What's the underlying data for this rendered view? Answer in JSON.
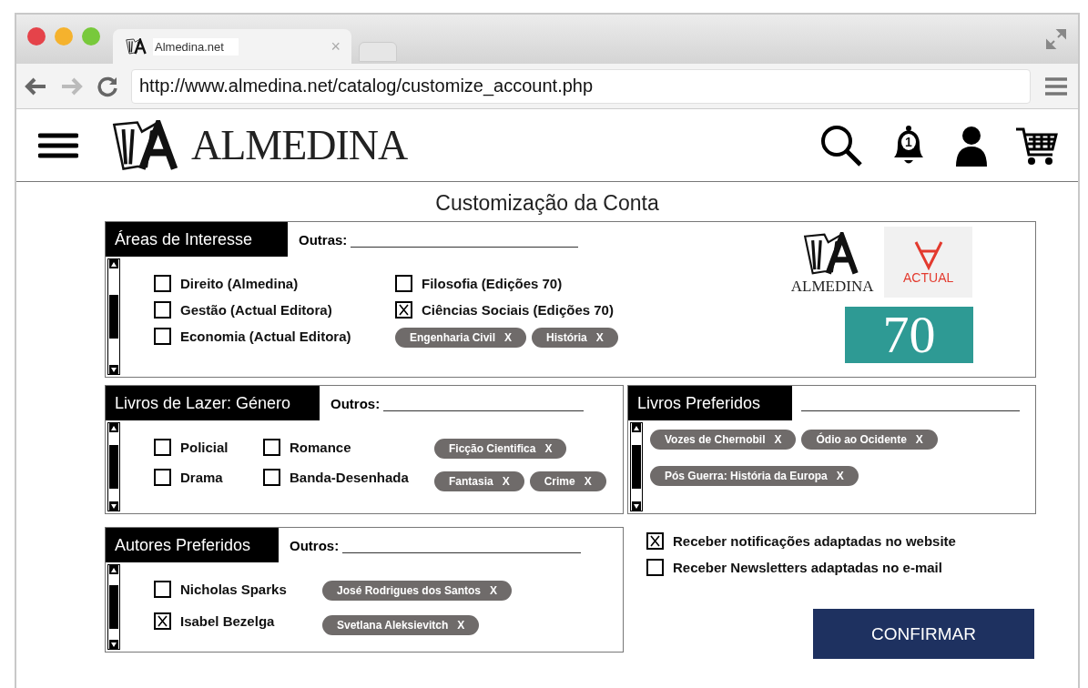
{
  "browser": {
    "tab": {
      "title": "Almedina.net",
      "close": "×"
    },
    "address": "http://www.almedina.net/catalog/customize_account.php"
  },
  "header": {
    "logo": "ALMEDINA",
    "notification_count": "1"
  },
  "page_title": "Customização da Conta",
  "sections": [
    {
      "kind": "areas",
      "title": "Áreas de Interesse",
      "other_label": "Outras:",
      "columns": [
        [
          {
            "kind": "checkbox",
            "label": "Direito (Almedina)",
            "checked": false
          },
          {
            "kind": "checkbox",
            "label": "Gestão (Actual Editora)",
            "checked": false
          },
          {
            "kind": "checkbox",
            "label": "Economia (Actual Editora)",
            "checked": false
          }
        ],
        [
          {
            "kind": "checkbox",
            "label": "Filosofia (Edições 70)",
            "checked": false
          },
          {
            "kind": "checkbox",
            "label": "Ciências Sociais (Edições 70)",
            "checked": true
          },
          {
            "kind": "chips",
            "chips": [
              {
                "label": "Engenharia Civil",
                "remove": "X"
              },
              {
                "label": "História",
                "remove": "X"
              }
            ]
          }
        ]
      ],
      "logos": [
        {
          "kind": "almedina",
          "text": "ALMEDINA"
        },
        {
          "kind": "actual",
          "text": "ACTUAL"
        },
        {
          "kind": "seventy",
          "text": "70"
        }
      ]
    },
    {
      "kind": "lazer",
      "title": "Livros de Lazer: Género",
      "other_label": "Outros:",
      "columns": [
        [
          {
            "kind": "checkbox",
            "label": "Policial",
            "checked": false
          },
          {
            "kind": "checkbox",
            "label": "Drama",
            "checked": false
          }
        ],
        [
          {
            "kind": "checkbox",
            "label": "Romance",
            "checked": false
          },
          {
            "kind": "checkbox",
            "label": "Banda-Desenhada",
            "checked": false
          }
        ],
        [
          {
            "kind": "chips",
            "chips": [
              {
                "label": "Ficção Cientifica",
                "remove": "X"
              }
            ]
          },
          {
            "kind": "chips",
            "chips": [
              {
                "label": "Fantasia",
                "remove": "X"
              },
              {
                "label": "Crime",
                "remove": "X"
              }
            ]
          }
        ]
      ]
    },
    {
      "kind": "preferidos",
      "title": "Livros Preferidos",
      "columns": [
        [
          {
            "kind": "chips",
            "chips": [
              {
                "label": "Vozes de Chernobil",
                "remove": "X"
              },
              {
                "label": "Ódio ao Ocidente",
                "remove": "X"
              }
            ]
          },
          {
            "kind": "chips",
            "chips": [
              {
                "label": "Pós Guerra: História da Europa",
                "remove": "X"
              }
            ]
          }
        ]
      ]
    },
    {
      "kind": "autores",
      "title": "Autores Preferidos",
      "other_label": "Outros:",
      "columns": [
        [
          {
            "kind": "checkbox",
            "label": "Nicholas Sparks",
            "checked": false
          },
          {
            "kind": "checkbox",
            "label": "Isabel Bezelga",
            "checked": true
          }
        ],
        [
          {
            "kind": "chips",
            "chips": [
              {
                "label": "José Rodrigues dos Santos",
                "remove": "X"
              }
            ]
          },
          {
            "kind": "chips",
            "chips": [
              {
                "label": "Svetlana Aleksievitch",
                "remove": "X"
              }
            ]
          }
        ]
      ]
    }
  ],
  "preferences": [
    {
      "label": "Receber notificações adaptadas no website",
      "checked": true
    },
    {
      "label": "Receber Newsletters adaptadas no e-mail",
      "checked": false
    }
  ],
  "confirm_button": "CONFIRMAR"
}
